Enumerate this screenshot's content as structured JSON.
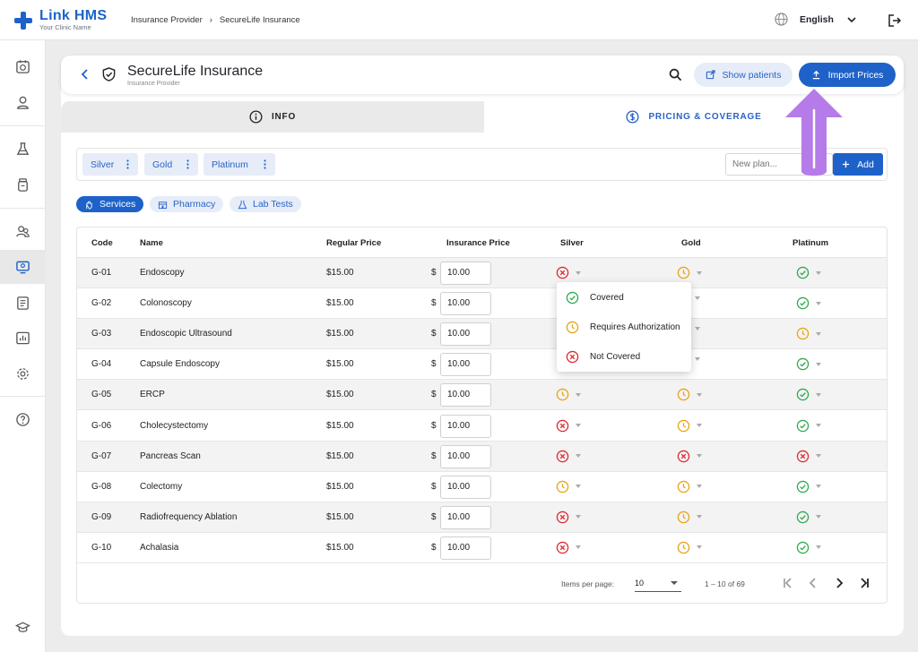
{
  "app": {
    "name": "Link HMS",
    "tagline": "Your Clinic Name"
  },
  "breadcrumb": [
    "Insurance Provider",
    "SecureLife Insurance"
  ],
  "language": "English",
  "header": {
    "title": "SecureLife Insurance",
    "subtitle": "Insurance Provider",
    "show_patients_label": "Show patients",
    "import_prices_label": "Import Prices"
  },
  "tabs": {
    "info": "INFO",
    "pricing": "PRICING & COVERAGE"
  },
  "plans": [
    "Silver",
    "Gold",
    "Platinum"
  ],
  "new_plan_placeholder": "New plan...",
  "add_label": "Add",
  "categories": [
    "Services",
    "Pharmacy",
    "Lab Tests"
  ],
  "table": {
    "headers": [
      "Code",
      "Name",
      "Regular Price",
      "Insurance Price",
      "Silver",
      "Gold",
      "Platinum"
    ],
    "currency_symbol": "$",
    "rows": [
      {
        "code": "G-01",
        "name": "Endoscopy",
        "regular": "$15.00",
        "insurance": "10.00",
        "silver": "not",
        "gold": "auth",
        "platinum": "covered"
      },
      {
        "code": "G-02",
        "name": "Colonoscopy",
        "regular": "$15.00",
        "insurance": "10.00",
        "silver": "",
        "gold": "",
        "platinum": "covered"
      },
      {
        "code": "G-03",
        "name": "Endoscopic Ultrasound",
        "regular": "$15.00",
        "insurance": "10.00",
        "silver": "",
        "gold": "",
        "platinum": "auth"
      },
      {
        "code": "G-04",
        "name": "Capsule Endoscopy",
        "regular": "$15.00",
        "insurance": "10.00",
        "silver": "",
        "gold": "",
        "platinum": "covered"
      },
      {
        "code": "G-05",
        "name": "ERCP",
        "regular": "$15.00",
        "insurance": "10.00",
        "silver": "auth",
        "gold": "auth",
        "platinum": "covered"
      },
      {
        "code": "G-06",
        "name": "Cholecystectomy",
        "regular": "$15.00",
        "insurance": "10.00",
        "silver": "not",
        "gold": "auth",
        "platinum": "covered"
      },
      {
        "code": "G-07",
        "name": "Pancreas Scan",
        "regular": "$15.00",
        "insurance": "10.00",
        "silver": "not",
        "gold": "not",
        "platinum": "not"
      },
      {
        "code": "G-08",
        "name": "Colectomy",
        "regular": "$15.00",
        "insurance": "10.00",
        "silver": "auth",
        "gold": "auth",
        "platinum": "covered"
      },
      {
        "code": "G-09",
        "name": "Radiofrequency Ablation",
        "regular": "$15.00",
        "insurance": "10.00",
        "silver": "not",
        "gold": "auth",
        "platinum": "covered"
      },
      {
        "code": "G-10",
        "name": "Achalasia",
        "regular": "$15.00",
        "insurance": "10.00",
        "silver": "not",
        "gold": "auth",
        "platinum": "covered"
      }
    ]
  },
  "status_menu": [
    "Covered",
    "Requires Authorization",
    "Not Covered"
  ],
  "paginator": {
    "label": "Items per page:",
    "page_size": "10",
    "range": "1 – 10 of 69"
  },
  "colors": {
    "primary": "#1e62c9",
    "covered": "#2fa84f",
    "auth": "#e8a317",
    "not": "#e0292f",
    "annotation": "#b57be8"
  }
}
